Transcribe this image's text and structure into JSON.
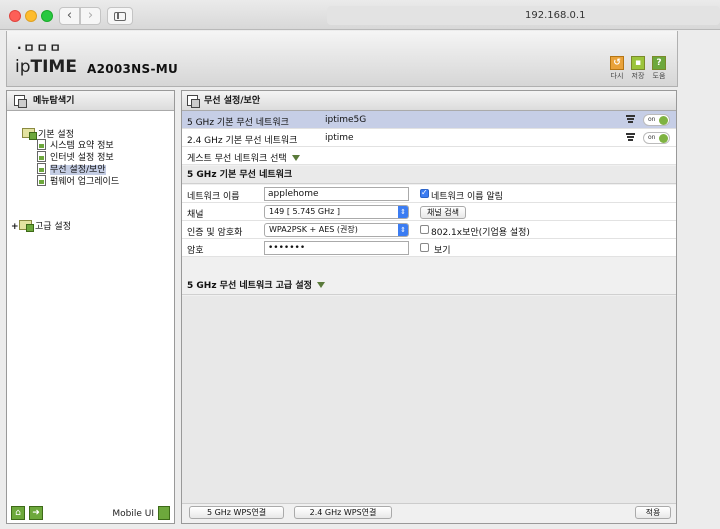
{
  "browser": {
    "url": "192.168.0.1"
  },
  "header": {
    "logo_dots": "·ㅁㅁㅁ",
    "logo_ip": "ip",
    "logo_time": "TIME",
    "model": "A2003NS-MU",
    "undo_label": "다시",
    "save_label": "저장",
    "help_label": "도움"
  },
  "left_menu": {
    "title": "메뉴탐색기",
    "basic_settings": "기본 설정",
    "items": [
      "시스템 요약 정보",
      "인터넷 설정 정보",
      "무선 설정/보안",
      "펌웨어 업그레이드"
    ],
    "selected_index": 2,
    "advanced_settings": "고급 설정",
    "mobile_ui": "Mobile UI"
  },
  "main": {
    "title": "무선 설정/보안",
    "networks": [
      {
        "label": "5 GHz 기본 무선 네트워크",
        "ssid": "iptime5G",
        "toggle": "on"
      },
      {
        "label": "2.4 GHz 기본 무선 네트워크",
        "ssid": "iptime",
        "toggle": "on"
      }
    ],
    "guest_label": "게스트 무선 네트워크 선택",
    "section_basic": "5 GHz 기본 무선 네트워크",
    "form": {
      "network_name_label": "네트워크 이름",
      "network_name_value": "applehome",
      "broadcast_label": "네트워크 이름 알림",
      "broadcast_checked": true,
      "channel_label": "채널",
      "channel_value": "149 [ 5.745 GHz ]",
      "channel_search_button": "채널 검색",
      "auth_label": "인증 및 암호화",
      "auth_value": "WPA2PSK + AES (권장)",
      "enterprise_label": "802.1x보안(기업용 설정)",
      "enterprise_checked": false,
      "password_label": "암호",
      "password_value": "•••••••",
      "show_label": "보기",
      "show_checked": false
    },
    "section_advanced": "5 GHz 무선 네트워크 고급 설정",
    "footer": {
      "wps5_button": "5 GHz WPS연결",
      "wps24_button": "2.4 GHz WPS연결",
      "apply_button": "적용"
    }
  }
}
